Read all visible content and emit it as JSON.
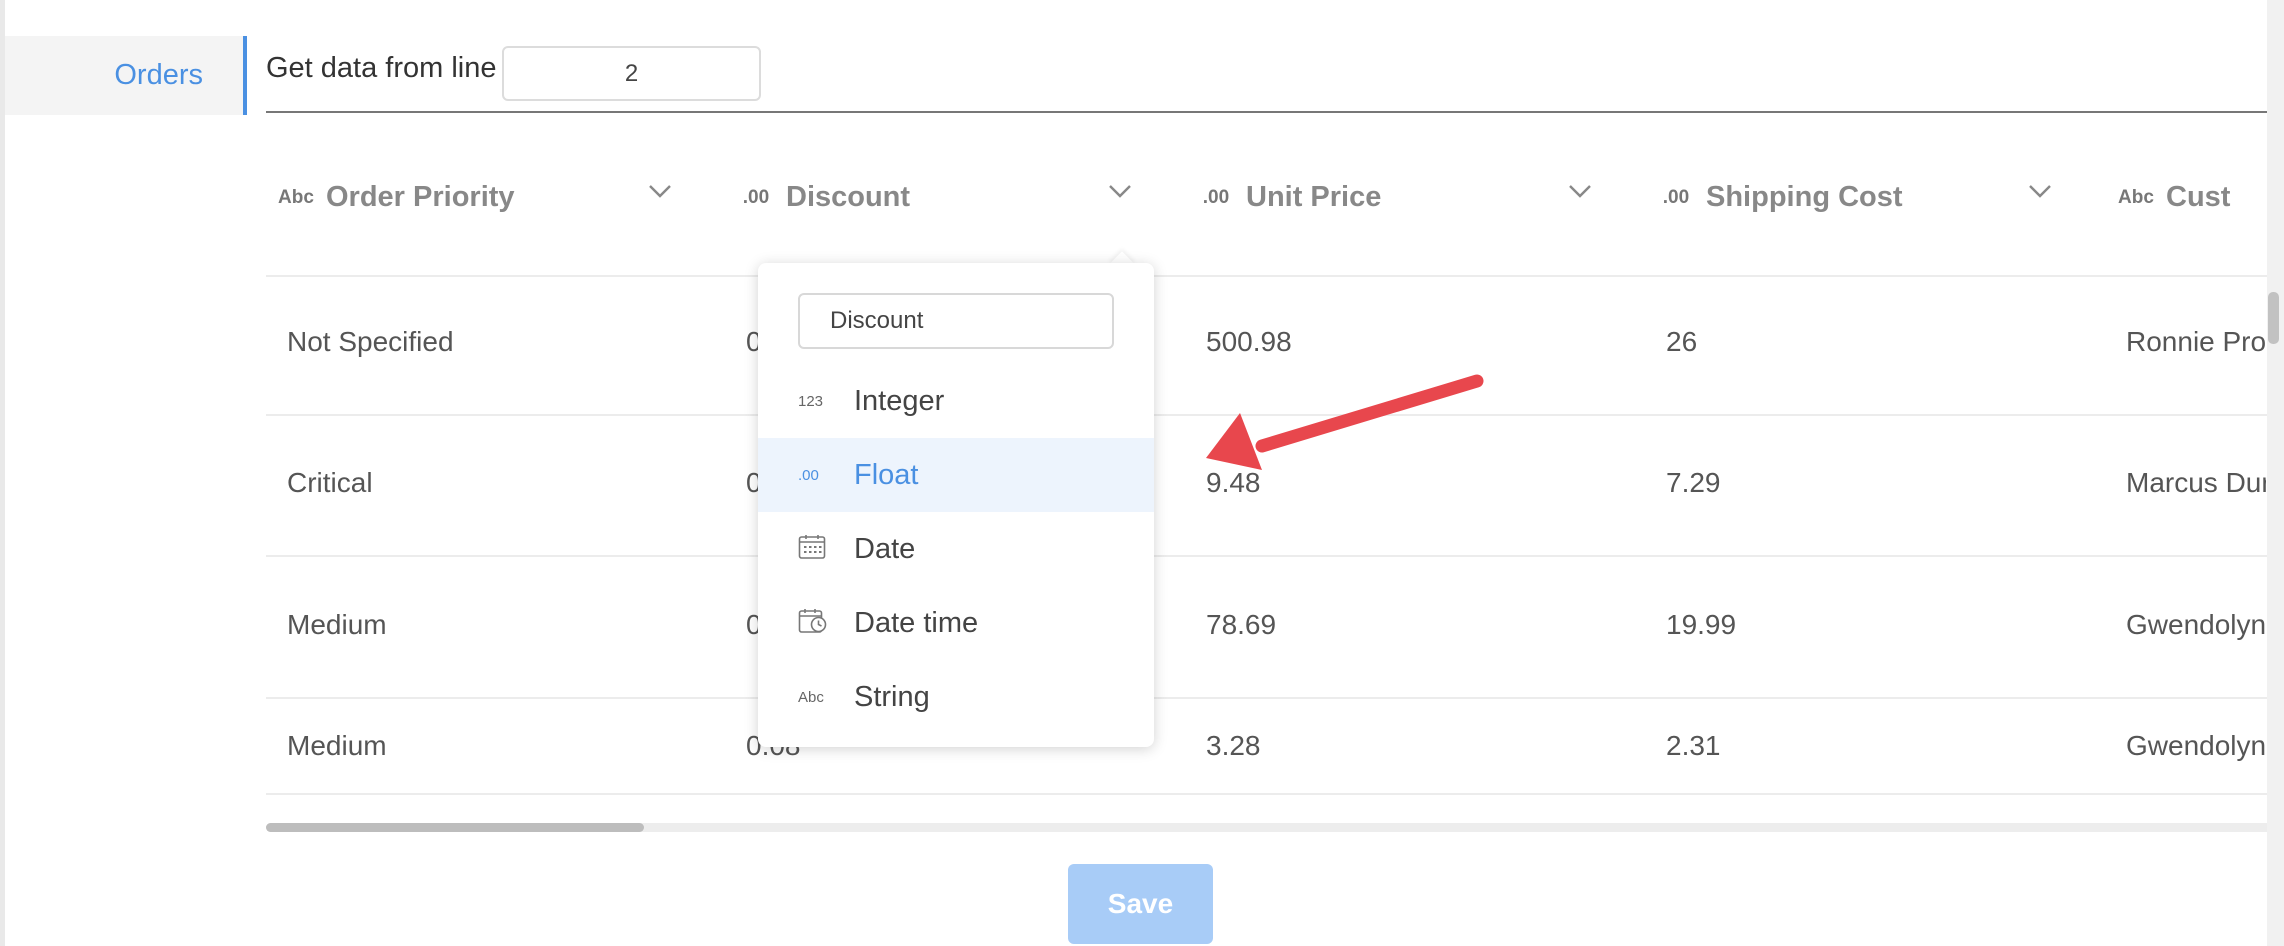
{
  "sheet_tab": "Orders",
  "line_label": "Get data from line",
  "line_value": "2",
  "columns": [
    {
      "type_icon": "Abc",
      "name": "Order Priority"
    },
    {
      "type_icon": ".00",
      "name": "Discount"
    },
    {
      "type_icon": ".00",
      "name": "Unit Price"
    },
    {
      "type_icon": ".00",
      "name": "Shipping Cost"
    },
    {
      "type_icon": "Abc",
      "name": "Cust"
    }
  ],
  "rows": [
    [
      "Not Specified",
      "0",
      "500.98",
      "26",
      "Ronnie Proc"
    ],
    [
      "Critical",
      "0",
      "9.48",
      "7.29",
      "Marcus Dur"
    ],
    [
      "Medium",
      "0",
      "78.69",
      "19.99",
      "Gwendolyn"
    ],
    [
      "Medium",
      "0.08",
      "3.28",
      "2.31",
      "Gwendolyn"
    ]
  ],
  "dropdown": {
    "search_value": "Discount",
    "options": [
      {
        "icon": "123",
        "label": "Integer"
      },
      {
        "icon": ".00",
        "label": "Float"
      },
      {
        "icon": "calendar-icon",
        "label": "Date"
      },
      {
        "icon": "calendar-clock-icon",
        "label": "Date time"
      },
      {
        "icon": "Abc",
        "label": "String"
      }
    ],
    "selected": "Float"
  },
  "save_label": "Save",
  "colors": {
    "accent": "#4a90e2",
    "annotation_arrow": "#e8474d",
    "save_button": "#a8ccf7"
  }
}
